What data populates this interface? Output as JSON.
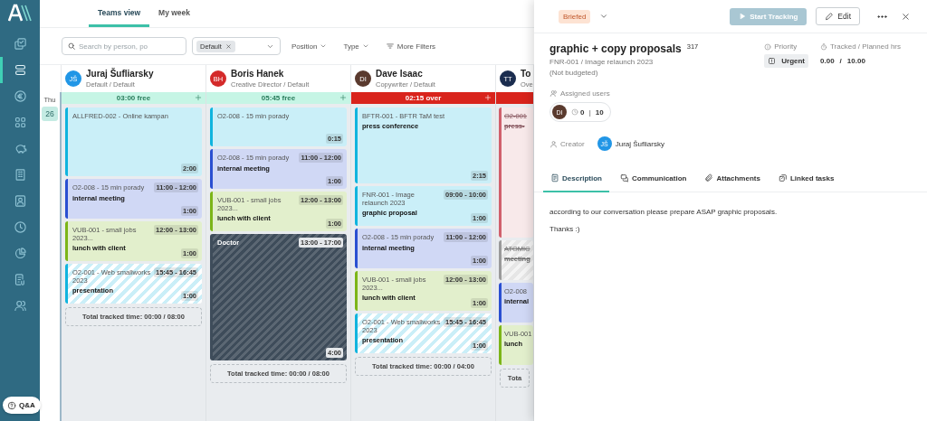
{
  "sidebar": {
    "items": [
      {
        "selected": false
      },
      {
        "selected": true
      },
      {
        "selected": false
      },
      {
        "selected": false
      },
      {
        "selected": false
      },
      {
        "selected": false
      },
      {
        "selected": false
      },
      {
        "selected": false
      },
      {
        "selected": false
      },
      {
        "selected": false
      },
      {
        "selected": false
      }
    ],
    "help_button": "Q&A"
  },
  "view_tabs": [
    {
      "label": "Teams view",
      "selected": true
    },
    {
      "label": "My week",
      "selected": false
    }
  ],
  "filters": {
    "search": {
      "placeholder": "Search by person, po"
    },
    "chips": [
      "Default"
    ],
    "dropdowns": [
      "Position",
      "Type"
    ],
    "more_filters": "More Filters"
  },
  "day": {
    "weekday": "Thu",
    "date": "26"
  },
  "people": [
    {
      "initials": "JŠ",
      "color": "#2196e6",
      "name": "Juraj Šufliarsky",
      "role": "Default / Default",
      "capacity": {
        "kind": "free",
        "label": "03:00 free"
      },
      "total": "Total tracked time: 00:00 / 08:00",
      "cards": [
        {
          "kind": "task",
          "color": "#10b4de",
          "project": "ALLFRED-002 - Online kampan",
          "duration": "2:00"
        },
        {
          "kind": "task",
          "color": "#2a4fd1",
          "project": "O2-008 - 15 min porady",
          "time": "11:00 - 12:00",
          "title": "internal meeting",
          "duration": "1:00"
        },
        {
          "kind": "task",
          "color": "#7cb518",
          "project": "VUB-001 - small jobs 2023...",
          "time": "12:00 - 13:00",
          "title": "lunch with client",
          "duration": "1:00"
        },
        {
          "kind": "tentative",
          "color": "#10b4de",
          "project": "O2-001 - Web smallworks 2023",
          "time": "15:45 - 16:45",
          "title": "presentation",
          "duration": "1:00"
        }
      ]
    },
    {
      "initials": "BH",
      "color": "#d42a2a",
      "name": "Boris Hanek",
      "role": "Creative Director / Default",
      "capacity": {
        "kind": "free",
        "label": "05:45 free"
      },
      "total": "Total tracked time: 00:00 / 08:00",
      "cards": [
        {
          "kind": "task",
          "color": "#10b4de",
          "project": "O2-008 - 15 min porady",
          "duration": "0:15"
        },
        {
          "kind": "task",
          "color": "#2a4fd1",
          "project": "O2-008 - 15 min porady",
          "time": "11:00 - 12:00",
          "title": "internal meeting",
          "duration": "1:00"
        },
        {
          "kind": "task",
          "color": "#7cb518",
          "project": "VUB-001 - small jobs 2023...",
          "time": "12:00 - 13:00",
          "title": "lunch with client",
          "duration": "1:00"
        },
        {
          "kind": "absence",
          "color": "#3e4c5a",
          "project": "Doctor",
          "time": "13:00 - 17:00",
          "duration": "4:00"
        }
      ]
    },
    {
      "initials": "DI",
      "color": "#5a3a2e",
      "name": "Dave Isaac",
      "role": "Copywriter / Default",
      "capacity": {
        "kind": "over",
        "label": "02:15 over"
      },
      "total": "Total tracked time: 00:00 / 04:00",
      "cards": [
        {
          "kind": "task",
          "color": "#10b4de",
          "project": "BFTR-001 - BFTR TaM test",
          "title": "press conference",
          "duration": "2:15"
        },
        {
          "kind": "task",
          "color": "#10b4de",
          "project": "FNR-001 - Image relaunch 2023",
          "time": "09:00 - 10:00",
          "title": "graphic proposal",
          "duration": "1:00"
        },
        {
          "kind": "task",
          "color": "#2a4fd1",
          "project": "O2-008 - 15 min porady",
          "time": "11:00 - 12:00",
          "title": "internal meeting",
          "duration": "1:00"
        },
        {
          "kind": "task",
          "color": "#7cb518",
          "project": "VUB-001 - small jobs 2023...",
          "time": "12:00 - 13:00",
          "title": "lunch with client",
          "duration": "1:00"
        },
        {
          "kind": "tentative",
          "color": "#10b4de",
          "project": "O2-001 - Web smallworks 2023",
          "time": "15:45 - 16:45",
          "title": "presentation",
          "duration": "1:00"
        }
      ]
    },
    {
      "initials": "TT",
      "color": "#1b2d4f",
      "name": "To",
      "role": "Ove",
      "capacity": {
        "kind": "over"
      },
      "total": "Tota",
      "cards": [
        {
          "kind": "cancelled",
          "color": "#d0606c",
          "project": "O2-001",
          "title": "press-"
        },
        {
          "kind": "cancelled-tentative",
          "color": "#9a9a9a",
          "project": "ATOMIC",
          "title": "meeting"
        },
        {
          "kind": "task",
          "color": "#2a4fd1",
          "project": "O2-008",
          "title": "internal"
        },
        {
          "kind": "task",
          "color": "#7cb518",
          "project": "VUB-001",
          "title": "lunch"
        }
      ]
    }
  ],
  "detail": {
    "status": "Briefed",
    "start_button": {
      "label": "Start Tracking",
      "disabled": true
    },
    "edit_button": "Edit",
    "title": "graphic + copy proposals",
    "number": "317",
    "project": "FNR-001 / Image relaunch 2023",
    "budget": "(Not budgeted)",
    "priority": {
      "label": "Priority",
      "value": "Urgent"
    },
    "tracked": {
      "label": "Tracked / Planned hrs",
      "tracked": "0.00",
      "separator": "/",
      "planned": "10.00"
    },
    "assigned": {
      "label": "Assigned users",
      "users": [
        {
          "initials": "DI",
          "color": "#5a3a2e",
          "tracked": "0",
          "separator": "|",
          "planned": "10"
        }
      ]
    },
    "creator": {
      "label": "Creator",
      "initials": "JŠ",
      "color": "#2196e6",
      "name": "Juraj Šufliarsky"
    },
    "tabs": [
      {
        "label": "Description",
        "selected": true
      },
      {
        "label": "Communication",
        "selected": false
      },
      {
        "label": "Attachments",
        "selected": false
      },
      {
        "label": "Linked tasks",
        "selected": false
      }
    ],
    "description": [
      "according to our conversation please prepare ASAP graphic proposals.",
      "Thanks :)"
    ]
  }
}
